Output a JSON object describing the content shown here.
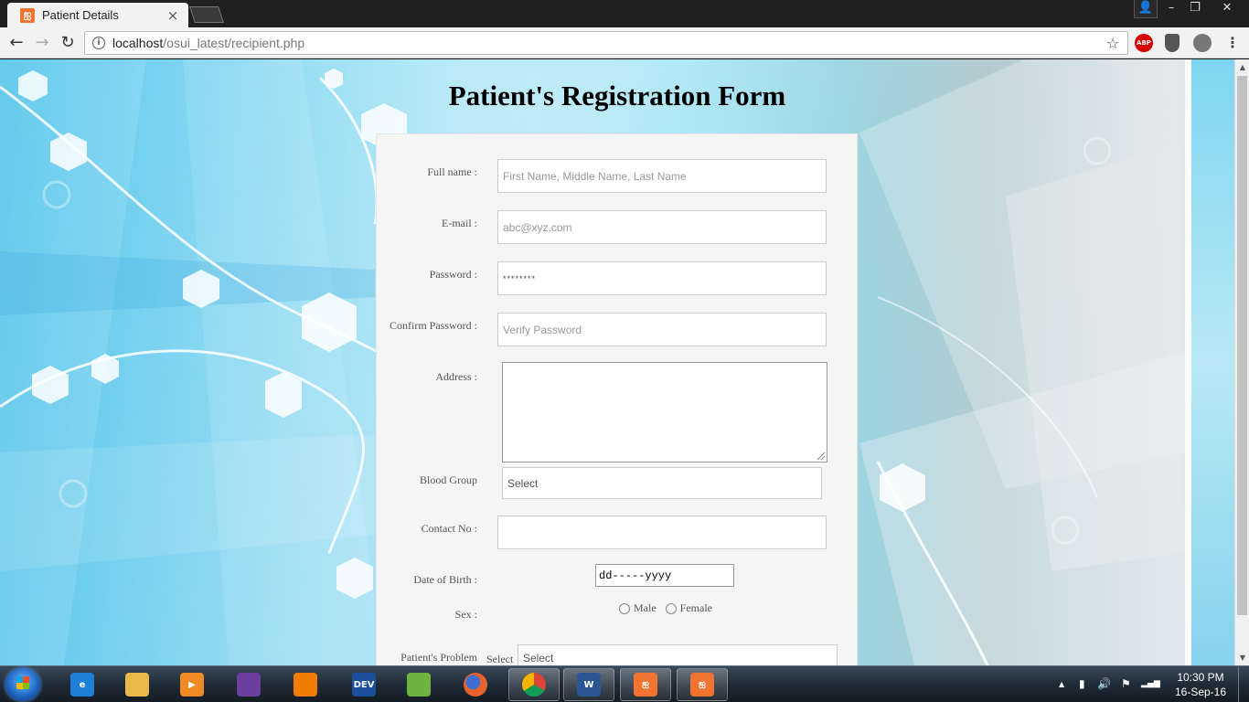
{
  "browser": {
    "tab": {
      "title": "Patient Details",
      "close": "×",
      "favicon": "xampp-icon"
    },
    "window_controls": {
      "profile": "👤",
      "minimize": "–",
      "maximize": "❐",
      "close": "✕"
    },
    "toolbar": {
      "back": "←",
      "forward": "→",
      "reload": "↻",
      "url_host": "localhost",
      "url_path": "/osui_latest/recipient.php",
      "star": "☆",
      "extensions": [
        {
          "name": "adblock-plus-icon",
          "label": "ABP"
        },
        {
          "name": "shield-extension-icon",
          "label": ""
        },
        {
          "name": "ghostery-icon",
          "label": ""
        }
      ],
      "menu": "⋮"
    }
  },
  "page": {
    "title": "Patient's Registration Form",
    "form": {
      "full_name": {
        "label": "Full name :",
        "placeholder": "First Name, Middle Name, Last Name"
      },
      "email": {
        "label": "E-mail :",
        "placeholder": "abc@xyz.com"
      },
      "password": {
        "label": "Password :",
        "value": "********"
      },
      "confirm_password": {
        "label": "Confirm Password :",
        "placeholder": "Verify Password"
      },
      "address": {
        "label": "Address :",
        "value": ""
      },
      "blood_group": {
        "label": "Blood Group",
        "selected": "Select"
      },
      "contact": {
        "label": "Contact No :",
        "value": ""
      },
      "dob": {
        "label": "Date of Birth :",
        "value": "dd-----yyyy"
      },
      "sex": {
        "label": "Sex :",
        "options": [
          "Male",
          "Female"
        ]
      },
      "problem": {
        "label": "Patient's Problem",
        "prefix": "Select",
        "selected": "Select"
      }
    }
  },
  "taskbar": {
    "apps": [
      {
        "name": "ie-icon",
        "label": "e",
        "color": "#1e7fd6"
      },
      {
        "name": "explorer-icon",
        "label": "",
        "color": "#e8b84a"
      },
      {
        "name": "media-player-icon",
        "label": "▶",
        "color": "#f08a24"
      },
      {
        "name": "visual-studio-icon",
        "label": "",
        "color": "#6b3fa0"
      },
      {
        "name": "vlc-icon",
        "label": "",
        "color": "#f07d00"
      },
      {
        "name": "devcpp-icon",
        "label": "DEV",
        "color": "#1b4f9c"
      },
      {
        "name": "notepadpp-icon",
        "label": "",
        "color": "#6db33f"
      },
      {
        "name": "firefox-icon",
        "label": "",
        "color": "#e8632b"
      },
      {
        "name": "chrome-icon",
        "label": "",
        "color": "#ffffff"
      },
      {
        "name": "word-icon",
        "label": "W",
        "color": "#2b5797"
      },
      {
        "name": "xampp-icon",
        "label": "ஐ",
        "color": "#f27430"
      },
      {
        "name": "xampp-control-icon",
        "label": "ஐ",
        "color": "#f27430"
      }
    ],
    "tray": {
      "arrow": "▲",
      "battery": "▮",
      "volume": "🔊",
      "flag": "⚑",
      "signal": "▂▄▆"
    },
    "clock": {
      "time": "10:30 PM",
      "date": "16-Sep-16"
    }
  }
}
